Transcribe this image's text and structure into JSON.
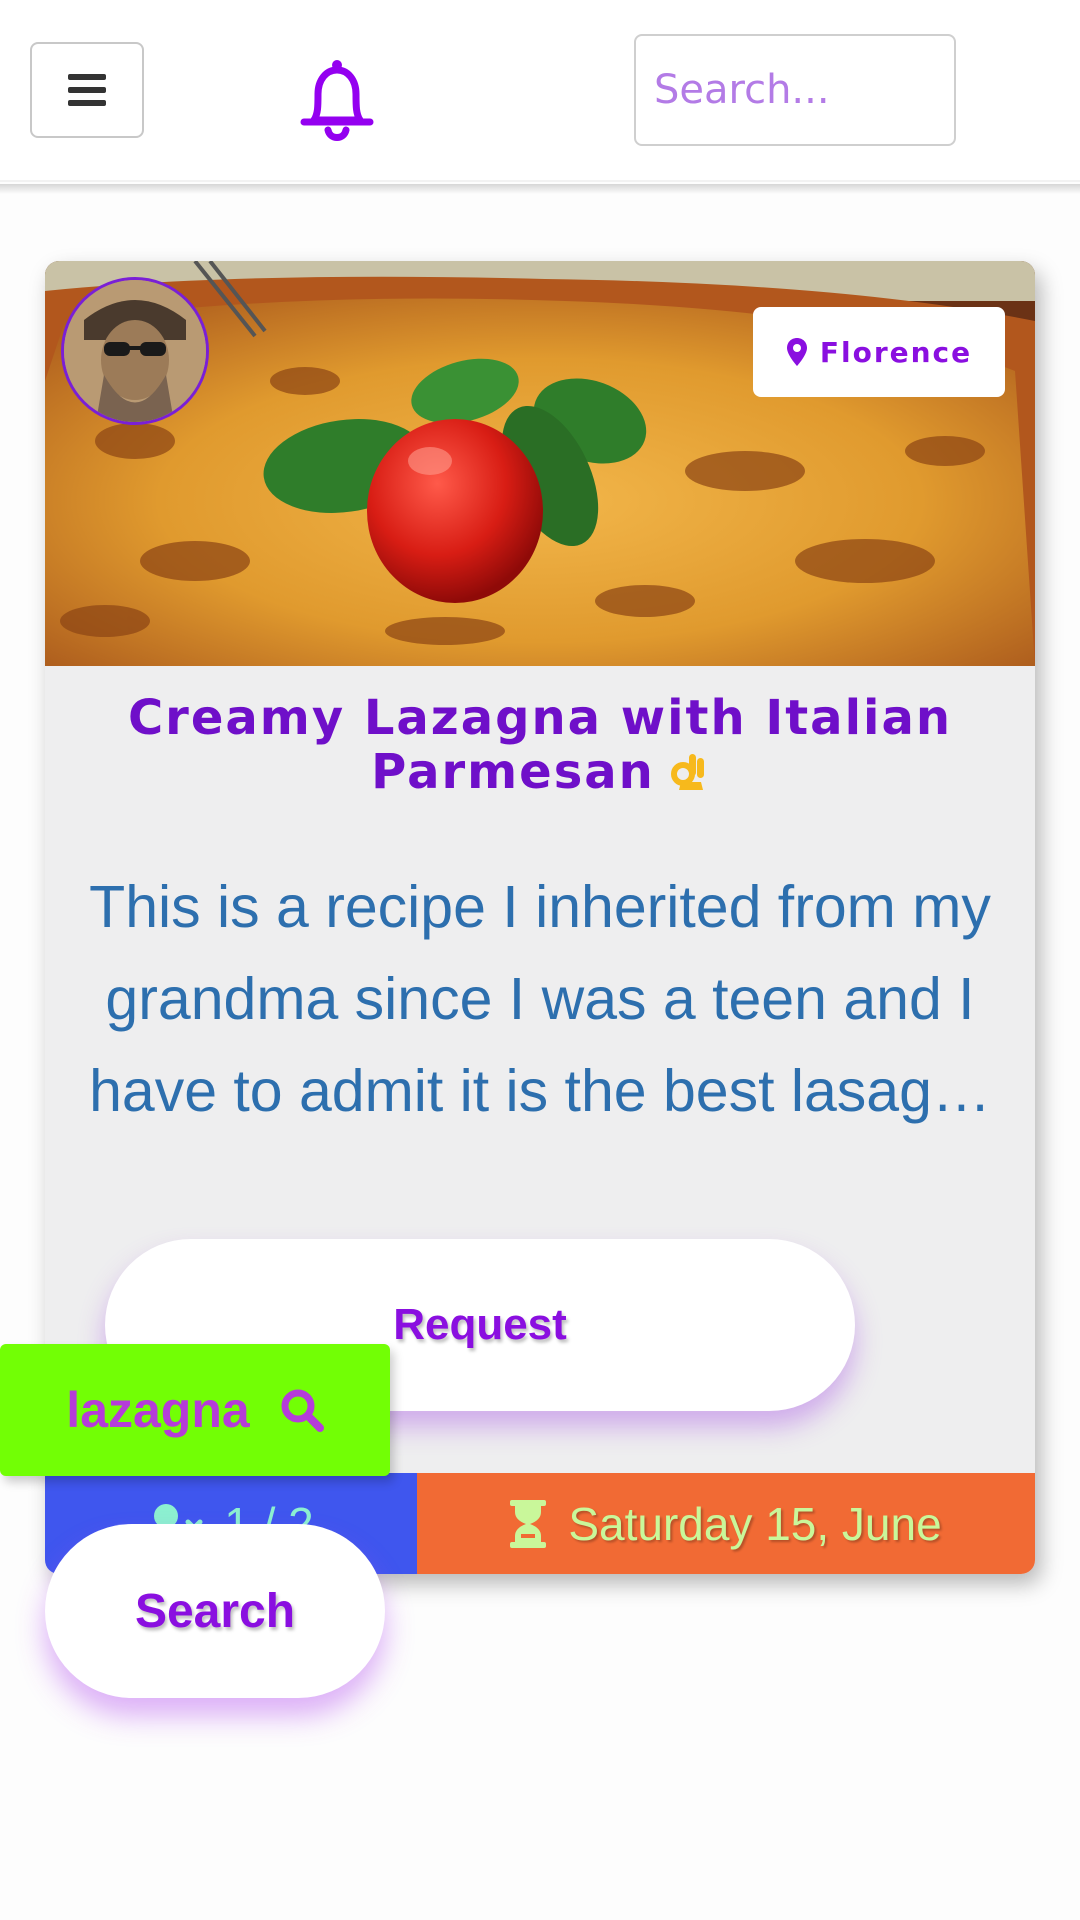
{
  "header": {
    "search_placeholder": "Search..."
  },
  "card": {
    "location": "Florence",
    "title": "Creamy Lazagna with Italian Parmesan",
    "description": "This is a recipe I inherited from my grandma since I was a teen and I have to admit it is the best lasag…",
    "request_label": "Request",
    "participants": "1 / 2",
    "date": "Saturday 15, June"
  },
  "overlay": {
    "search_term": "lazagna",
    "search_button_label": "Search"
  },
  "icons": {
    "menu": "hamburger-menu-icon",
    "notifications": "bell-icon",
    "location": "map-pin-icon",
    "participants": "user-x-icon",
    "date": "hourglass-icon",
    "search": "magnifier-icon",
    "title_emoji": "ok-hand-emoji"
  },
  "colors": {
    "accent_purple": "#8a0fe0",
    "title_purple": "#6f0fc9",
    "description_blue": "#2d6fae",
    "chip_green": "#72ff05",
    "footer_blue": "#3f56ee",
    "footer_orange": "#f16a34"
  }
}
